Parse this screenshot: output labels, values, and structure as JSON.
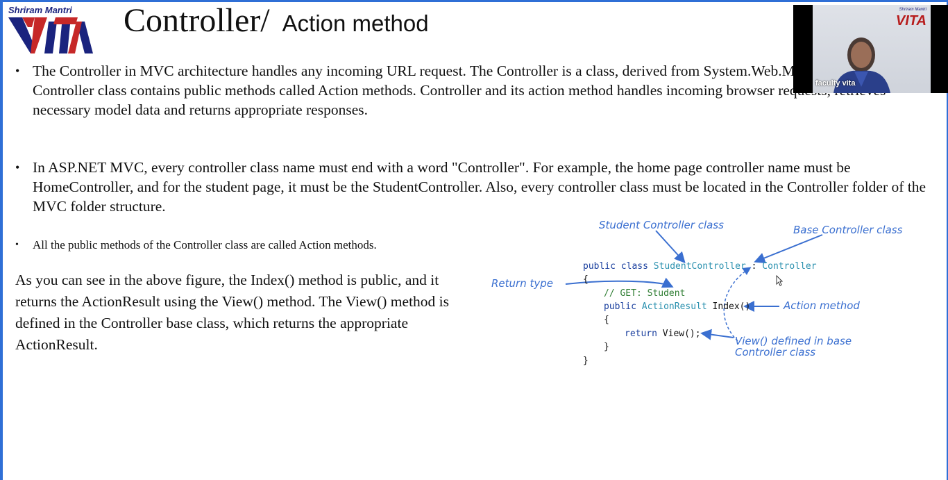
{
  "logo": {
    "top_text": "Shriram Mantri",
    "wordmark": "VITA"
  },
  "slide": {
    "title_main": "Controller/",
    "title_sub": "Action method",
    "bullets": [
      "The Controller in MVC architecture handles any incoming URL request. The Controller is a class, derived from System.Web.Mvc.Controller. Controller class contains public methods called Action methods. Controller and its action method handles incoming browser requests, retrieves necessary model data and returns appropriate responses.",
      "In ASP.NET MVC, every controller class name must end with a word \"Controller\". For example, the home page controller name must be HomeController, and for the student page, it must be the StudentController. Also, every controller class must be located in the Controller folder of the MVC folder structure.",
      "All the public methods of the Controller class are called Action methods."
    ],
    "paragraph": "As you can see in the above figure, the Index() method is public, and it returns the ActionResult using the View() method. The View() method is defined in the Controller base class, which returns the appropriate ActionResult.",
    "bullet_glyph": "•"
  },
  "diagram": {
    "code": {
      "line1_kw": "public class ",
      "line1_cls": "StudentController",
      "line1_sep": " : ",
      "line1_base": "Controller",
      "open_brace": "{",
      "comment": "// GET: Student",
      "line3_kw": "public ",
      "line3_type": "ActionResult",
      "line3_method": " Index()",
      "inner_open": "{",
      "return_kw": "return",
      "return_call": " View();",
      "inner_close": "}",
      "close_brace": "}"
    },
    "annotations": {
      "student_controller_class": "Student Controller class",
      "base_controller_class": "Base Controller class",
      "return_type": "Return type",
      "action_method": "Action method",
      "view_defined_line1": "View() defined in base",
      "view_defined_line2": "Controller class"
    },
    "colors": {
      "annotation": "#3a6fd0",
      "keyword": "#1a3f9e",
      "class_name": "#2b91af",
      "comment": "#2e7d32"
    }
  },
  "video": {
    "participant_name": "faculty vita",
    "background_logo": "VITA",
    "background_logo_top": "Shriram Mantri"
  },
  "theme": {
    "frame_border": "#2f6fd6",
    "logo_red": "#c62828",
    "logo_navy": "#1a237e"
  }
}
